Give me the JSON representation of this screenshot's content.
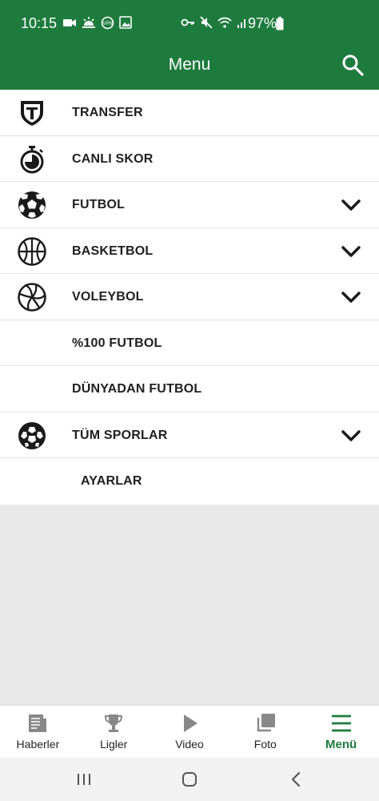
{
  "status_bar": {
    "time": "10:15",
    "battery": "97%",
    "left_icons": [
      "video-call-icon",
      "sunrise-icon",
      "vpn-icon",
      "image-icon"
    ],
    "right_icons": [
      "key-icon",
      "mute-icon",
      "wifi-icon",
      "signal-icon",
      "battery-icon"
    ]
  },
  "header": {
    "title": "Menu",
    "search_icon": "search-icon",
    "background": "#1e7b3e"
  },
  "menu": {
    "items": [
      {
        "label": "TRANSFER",
        "icon": "transfer-shield-icon",
        "expandable": false
      },
      {
        "label": "CANLI SKOR",
        "icon": "stopwatch-icon",
        "expandable": false
      },
      {
        "label": "FUTBOL",
        "icon": "soccer-ball-icon",
        "expandable": true
      },
      {
        "label": "BASKETBOL",
        "icon": "basketball-icon",
        "expandable": true
      },
      {
        "label": "VOLEYBOL",
        "icon": "volleyball-icon",
        "expandable": true
      },
      {
        "label": "%100 FUTBOL",
        "icon": "",
        "expandable": false
      },
      {
        "label": "DÜNYADAN FUTBOL",
        "icon": "",
        "expandable": false
      },
      {
        "label": "TÜM SPORLAR",
        "icon": "handball-icon",
        "expandable": true
      },
      {
        "label": "AYARLAR",
        "icon": "",
        "expandable": false
      }
    ]
  },
  "bottom_nav": {
    "items": [
      {
        "label": "Haberler",
        "icon": "news-icon"
      },
      {
        "label": "Ligler",
        "icon": "trophy-icon"
      },
      {
        "label": "Video",
        "icon": "play-icon"
      },
      {
        "label": "Foto",
        "icon": "photos-icon"
      },
      {
        "label": "Menü",
        "icon": "hamburger-icon",
        "active": true
      }
    ],
    "active_color": "#1e7b3e"
  },
  "system_nav": {
    "buttons": [
      "recents-icon",
      "home-icon",
      "back-icon"
    ]
  }
}
